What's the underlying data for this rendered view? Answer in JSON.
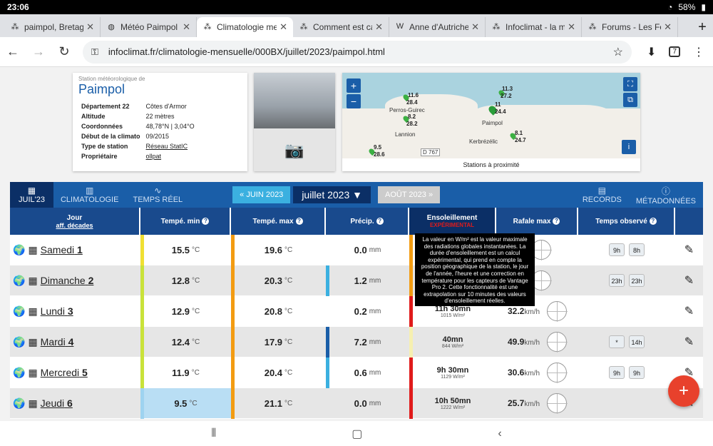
{
  "status": {
    "time": "23:06",
    "battery": "58%"
  },
  "tabs": [
    {
      "title": "paimpol, Bretagne",
      "fav": "ic"
    },
    {
      "title": "Météo Paimpol",
      "fav": "globe"
    },
    {
      "title": "Climatologie mensue",
      "fav": "ic"
    },
    {
      "title": "Comment est calcu",
      "fav": "ic"
    },
    {
      "title": "Anne d'Autriche : po",
      "fav": "W"
    },
    {
      "title": "Infoclimat - la mété",
      "fav": "ic"
    },
    {
      "title": "Forums - Les Forun",
      "fav": "ic"
    }
  ],
  "browser": {
    "url": "infoclimat.fr/climatologie-mensuelle/000BX/juillet/2023/paimpol.html",
    "tab_count": "7"
  },
  "station": {
    "subtitle": "Station météorologique de",
    "name": "Paimpol",
    "rows": [
      {
        "k": "Département 22",
        "v": "Côtes d'Armor"
      },
      {
        "k": "Altitude",
        "v": "22 mètres"
      },
      {
        "k": "Coordonnées",
        "v": "48,78°N | 3,04°O"
      },
      {
        "k": "Début de la climato",
        "v": "09/2015"
      },
      {
        "k": "Type de station",
        "v": "Réseau StatIC"
      },
      {
        "k": "Propriétaire",
        "v": "ollpat"
      }
    ]
  },
  "map": {
    "footer": "Stations à proximité",
    "plus": "+",
    "minus": "−",
    "labels": [
      "Perros-Guirec",
      "Lannion",
      "Paimpol",
      "Kerbrézélic",
      "D 767"
    ],
    "temps": [
      "11.6",
      "28.4",
      "8.2",
      "28.2",
      "9.5",
      "28.6",
      "11.3",
      "27.2",
      "11",
      "24.4",
      "8.1",
      "24.7"
    ]
  },
  "nav": {
    "month_tab": "JUIL'23",
    "climato": "CLIMATOLOGIE",
    "temps_reel": "TEMPS RÉEL",
    "prev": "« JUIN 2023",
    "current": "juillet 2023",
    "next": "AOÛT 2023 »",
    "records": "RECORDS",
    "meta": "MÉTADONNÉES"
  },
  "headers": {
    "day": "Jour",
    "decades": "aff. décades",
    "tmin": "Tempé. min",
    "tmax": "Tempé. max",
    "precip": "Précip.",
    "sun": "Ensoleillement",
    "sun_badge": "EXPÉRIMENTAL",
    "gust": "Rafale max",
    "weather": "Temps observé"
  },
  "tooltip": "La valeur en W/m² est la valeur maximale des radiations globales instantanées. La durée d'ensoleillement est un calcul expérimental, qui prend en compte la position géographique de la station, le jour de l'année, l'heure et une correction en température pour les capteurs de Vantage Pro 2. Cette fonctionnalité est une extrapolation sur 10 minutes des valeurs d'ensoleillement réelles.",
  "units": {
    "temp": "°C",
    "mm": "mm",
    "kmh": "km/h"
  },
  "rows": [
    {
      "day": "Samedi",
      "num": "1",
      "tmin": "15.5",
      "tmax": "19.6",
      "precip": "0.0",
      "sun": "",
      "sunw": "",
      "gust": "",
      "wx": [
        "9h",
        "8h"
      ]
    },
    {
      "day": "Dimanche",
      "num": "2",
      "tmin": "12.8",
      "tmax": "20.3",
      "precip": "1.2",
      "sun": "",
      "sunw": "",
      "gust": "",
      "wx": [
        "23h",
        "23h"
      ]
    },
    {
      "day": "Lundi",
      "num": "3",
      "tmin": "12.9",
      "tmax": "20.8",
      "precip": "0.2",
      "sun": "11h 30mn",
      "sunw": "1015 W/m²",
      "gust": "32.2",
      "wx": []
    },
    {
      "day": "Mardi",
      "num": "4",
      "tmin": "12.4",
      "tmax": "17.9",
      "precip": "7.2",
      "sun": "40mn",
      "sunw": "844 W/m²",
      "gust": "49.9",
      "wx": [
        "*",
        "14h"
      ]
    },
    {
      "day": "Mercredi",
      "num": "5",
      "tmin": "11.9",
      "tmax": "20.4",
      "precip": "0.6",
      "sun": "9h 30mn",
      "sunw": "1129 W/m²",
      "gust": "30.6",
      "wx": [
        "9h",
        "9h"
      ]
    },
    {
      "day": "Jeudi",
      "num": "6",
      "tmin": "9.5",
      "tmax": "21.1",
      "precip": "0.0",
      "sun": "10h 50mn",
      "sunw": "1222 W/m²",
      "gust": "25.7",
      "wx": []
    }
  ],
  "colors": {
    "tmin_bars": [
      "#f0e033",
      "#c9e23a",
      "#c9e23a",
      "#c9e23a",
      "#c9e23a",
      "#9ed3f0"
    ],
    "tmax_bars": [
      "#f39c12",
      "#f39c12",
      "#f39c12",
      "#f39c12",
      "#f39c12",
      "#f39c12"
    ],
    "precip_bars": [
      "",
      "#3bb0e0",
      "",
      "#1a5ea8",
      "#3bb0e0",
      ""
    ],
    "sun_bars": [
      "#f39c12",
      "#f39c12",
      "#e01b1b",
      "#f6f0b0",
      "#e01b1b",
      "#e01b1b"
    ],
    "accent": "#1a5ea8",
    "fab": "#e8412c"
  }
}
